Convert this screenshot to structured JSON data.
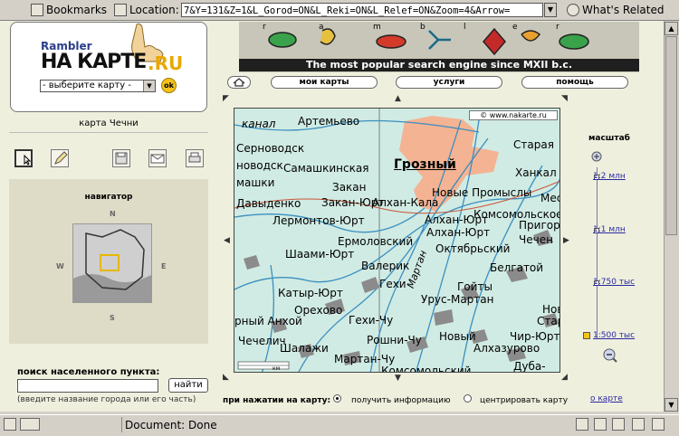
{
  "browser": {
    "bookmarks_label": "Bookmarks",
    "location_label": "Location:",
    "location_value": "7&Y=131&Z=1&L_Gorod=ON&L_Reki=ON&L_Relef=ON&Zoom=4&Arrow=",
    "whats_related_label": "What's Related",
    "status_text": "Document: Done"
  },
  "header": {
    "brand_top": "Rambler",
    "brand_main": "НА КАРТЕ",
    "brand_suffix": ".RU",
    "map_select_value": "- выберите карту -",
    "ok_label": "ok",
    "banner_tagline": "The most popular search engine since MXII b.c.",
    "banner_letters": [
      "r",
      "a",
      "m",
      "b",
      "l",
      "e",
      "r"
    ]
  },
  "nav": {
    "my_maps": "мои карты",
    "services": "услуги",
    "help": "помощь"
  },
  "left": {
    "map_title": "карта Чечни",
    "navigator_title": "навигатор",
    "compass": {
      "n": "N",
      "s": "S",
      "w": "W",
      "e": "E"
    },
    "search_label": "поиск населенного пункта:",
    "search_value": "",
    "search_button": "найти",
    "search_hint": "(введите название города или его часть)"
  },
  "map": {
    "copyright": "© www.nakarte.ru",
    "labels": [
      "канал",
      "Артемьево",
      "Серноводск",
      "новодск",
      "Самашкинская",
      "машки",
      "Закан",
      "Давыденко",
      "Закан-Юрт",
      "Алхан-Кала",
      "Лермонтов-Юрт",
      "Ермоловский",
      "Шаами-Юрт",
      "Валерик",
      "Катыр-Юрт",
      "Орехово",
      "рный Анхой",
      "Гехи",
      "Гехи-Чу",
      "Урус-Мартан",
      "Мартан",
      "Рошни-Чу",
      "Чечелич",
      "Шалажи",
      "Мартан-Чу",
      "Комсомольский",
      "Грозный",
      "Новые Промыслы",
      "Комсомольское",
      "Алхан-Юрт",
      "Октябрьский",
      "Гойты",
      "Белгатой",
      "Новый",
      "Алхазурово",
      "Старый",
      "Чир-Юрт",
      "Дуба-Юр",
      "Алхан-Юрт",
      "Старая",
      "Ханкал",
      "Мес",
      "Пригор",
      "Чечен",
      "Ново"
    ],
    "scalebar_label": "км"
  },
  "scale": {
    "title": "масштаб",
    "levels": [
      "1:2 млн",
      "1:1 млн",
      "1:750 тыс",
      "1:500 тыс"
    ],
    "about_map": "о карте"
  },
  "click_options": {
    "label": "при нажатии на карту:",
    "option_info": "получить информацию",
    "option_center": "центрировать карту",
    "selected": "получить информацию"
  },
  "colors": {
    "grozny_fill": "#f4b393",
    "water": "#3a8fc0",
    "map_bg": "#d0ebe3",
    "mountain": "#8b8b8b",
    "link_blue": "#2929a3"
  }
}
